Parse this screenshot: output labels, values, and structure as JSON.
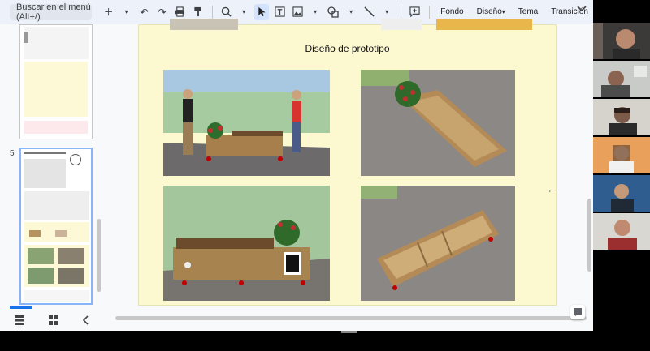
{
  "toolbar": {
    "search_placeholder": "Buscar en el menú (Alt+/)",
    "background_label": "Fondo",
    "layout_label": "Diseño",
    "theme_label": "Tema",
    "transition_label": "Transición"
  },
  "filmstrip": {
    "slide_number": "5"
  },
  "slide": {
    "title": "Diseño de prototipo"
  },
  "participants": [
    "participant-1",
    "participant-2",
    "participant-3",
    "participant-4",
    "participant-5",
    "participant-6"
  ]
}
